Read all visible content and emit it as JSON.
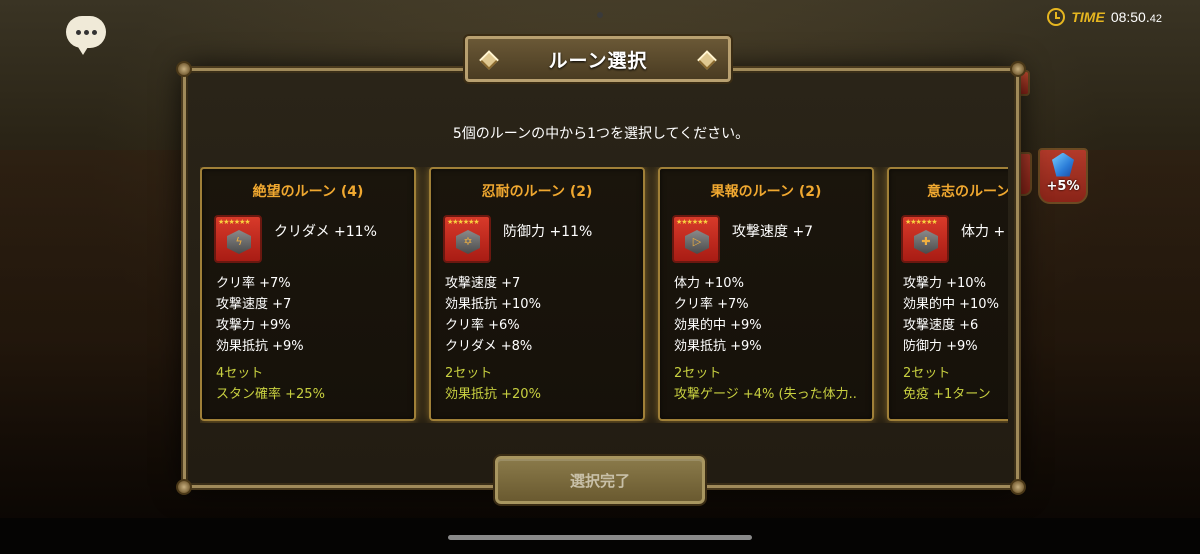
{
  "header": {
    "time_label": "TIME",
    "time_main": "08:50.",
    "time_sub": "42"
  },
  "dialog": {
    "title": "ルーン選択",
    "instruction": "5個のルーンの中から1つを選択してください。",
    "confirm_label": "選択完了"
  },
  "side": {
    "bonus_label": "+5%"
  },
  "runes": [
    {
      "name": "絶望のルーン (4)",
      "main_stat": "クリダメ +11%",
      "glyph": "ϟ",
      "sub_stats": [
        "クリ率 +7%",
        "攻撃速度 +7",
        "攻撃力 +9%",
        "効果抵抗 +9%"
      ],
      "set_count": "4セット",
      "set_effect": "スタン確率 +25%"
    },
    {
      "name": "忍耐のルーン (2)",
      "main_stat": "防御力 +11%",
      "glyph": "✡",
      "sub_stats": [
        "攻撃速度 +7",
        "効果抵抗 +10%",
        "クリ率 +6%",
        "クリダメ +8%"
      ],
      "set_count": "2セット",
      "set_effect": "効果抵抗 +20%"
    },
    {
      "name": "果報のルーン (2)",
      "main_stat": "攻撃速度 +7",
      "glyph": "▷",
      "sub_stats": [
        "体力 +10%",
        "クリ率 +7%",
        "効果的中 +9%",
        "効果抵抗 +9%"
      ],
      "set_count": "2セット",
      "set_effect": "攻撃ゲージ +4% (失った体力.."
    },
    {
      "name": "意志のルーン",
      "main_stat": "体力 +",
      "glyph": "✚",
      "sub_stats": [
        "攻撃力 +10%",
        "効果的中 +10%",
        "攻撃速度 +6",
        "防御力 +9%"
      ],
      "set_count": "2セット",
      "set_effect": "免疫 +1ターン"
    }
  ]
}
